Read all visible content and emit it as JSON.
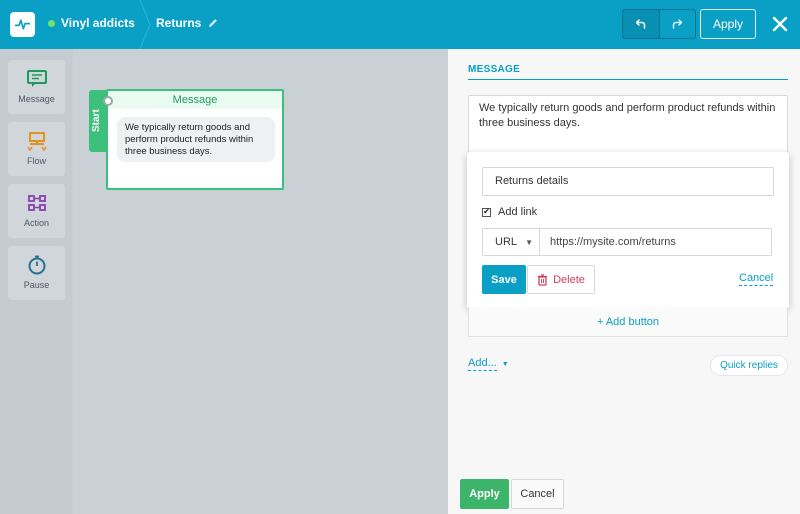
{
  "header": {
    "bot_name": "Vinyl addicts",
    "status_color": "#6ee36e",
    "page_title": "Returns",
    "apply_label": "Apply",
    "accent": "#0aa0c6"
  },
  "tools": [
    {
      "label": "Message",
      "icon": "message-icon"
    },
    {
      "label": "Flow",
      "icon": "flow-icon"
    },
    {
      "label": "Action",
      "icon": "action-icon"
    },
    {
      "label": "Pause",
      "icon": "pause-timer-icon"
    }
  ],
  "canvas": {
    "start_label": "Start",
    "node_title": "Message",
    "node_text": "We typically return goods and perform product refunds within three business days."
  },
  "panel": {
    "section_title": "MESSAGE",
    "message_text": "We typically return goods and perform product refunds within three business days.",
    "popup": {
      "button_title": "Returns details",
      "add_link_label": "Add link",
      "add_link_checked": true,
      "link_type": "URL",
      "link_value": "https://mysite.com/returns",
      "save_label": "Save",
      "delete_label": "Delete",
      "cancel_label": "Cancel"
    },
    "add_button_label": "+ Add button",
    "add_menu_label": "Add...",
    "quick_replies_label": "Quick replies",
    "apply_label": "Apply",
    "cancel_label": "Cancel"
  }
}
